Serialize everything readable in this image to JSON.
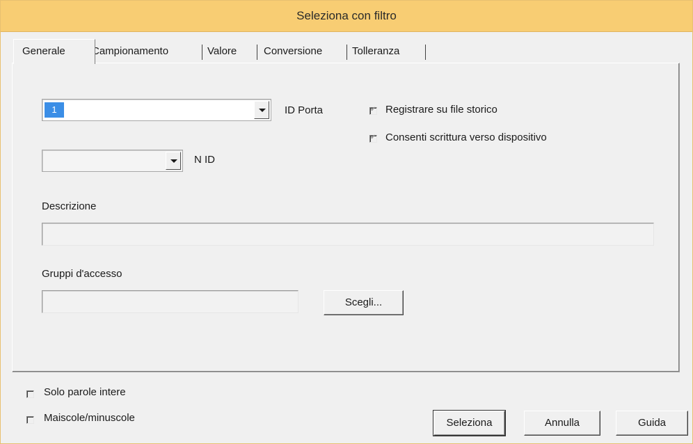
{
  "window": {
    "title": "Seleziona con filtro",
    "title_bar_color": "#f8cd73"
  },
  "tabs": [
    {
      "label": "Generale",
      "active": true
    },
    {
      "label": "Campionamento",
      "active": false
    },
    {
      "label": "Valore",
      "active": false
    },
    {
      "label": "Conversione",
      "active": false
    },
    {
      "label": "Tolleranza",
      "active": false
    }
  ],
  "general": {
    "port_combo": {
      "selected_value": "1",
      "label": "ID Porta"
    },
    "nid_combo": {
      "selected_value": "",
      "label": "N ID"
    },
    "checkboxes": [
      {
        "label": "Registrare su file storico",
        "checked": true,
        "disabled": true
      },
      {
        "label": "Consenti scrittura verso dispositivo",
        "checked": true,
        "disabled": true
      }
    ],
    "description": {
      "label": "Descrizione",
      "value": ""
    },
    "access_groups": {
      "label": "Gruppi d'accesso",
      "value": "",
      "choose_button": "Scegli..."
    }
  },
  "options": [
    {
      "label": "Solo parole intere",
      "checked": false
    },
    {
      "label": "Maiscole/minuscole",
      "checked": false
    }
  ],
  "buttons": {
    "select": "Seleziona",
    "cancel": "Annulla",
    "help": "Guida"
  }
}
